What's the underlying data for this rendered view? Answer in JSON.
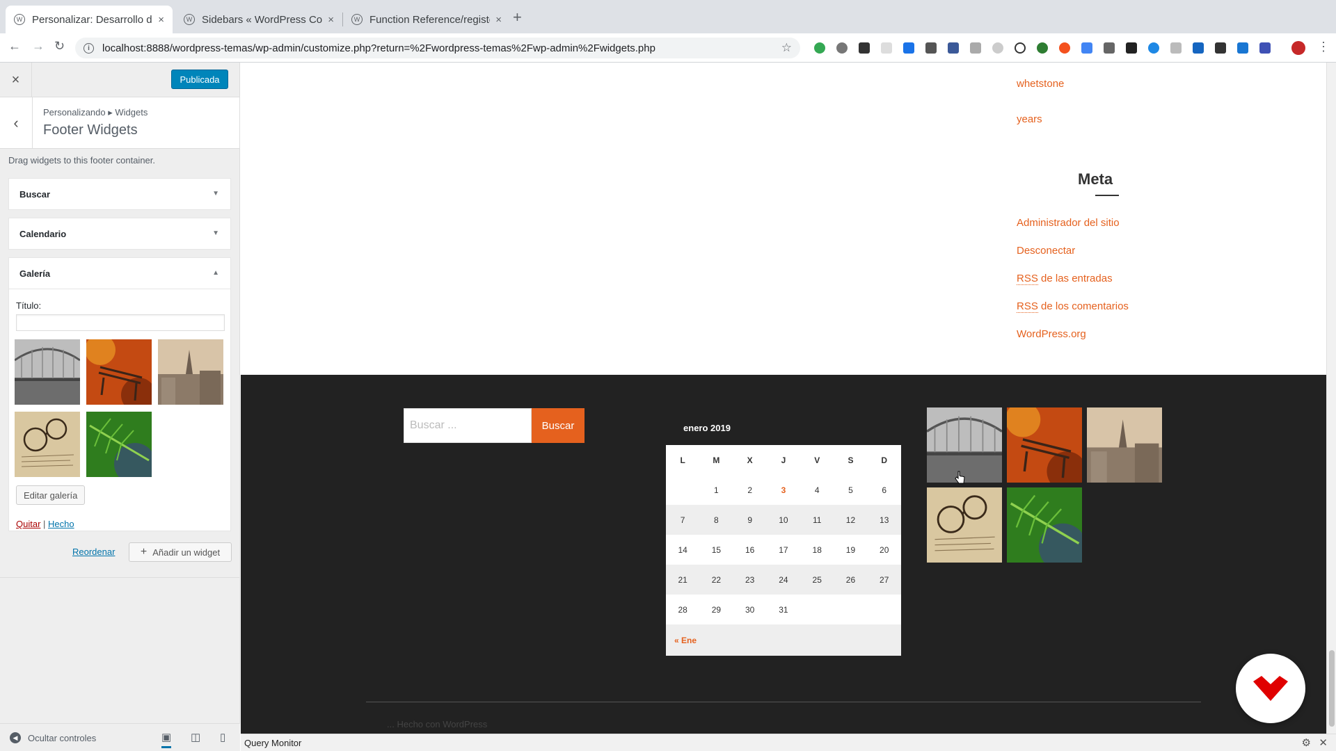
{
  "browser": {
    "tabs": [
      {
        "title": "Personalizar: Desarrollo de Ter",
        "active": true
      },
      {
        "title": "Sidebars « WordPress Codex",
        "active": false
      },
      {
        "title": "Function Reference/register si",
        "active": false
      }
    ],
    "close_glyph": "×",
    "new_tab_glyph": "+",
    "url": "localhost:8888/wordpress-temas/wp-admin/customize.php?return=%2Fwordpress-temas%2Fwp-admin%2Fwidgets.php",
    "icons": [
      "back-arrow",
      "forward-arrow",
      "reload",
      "info",
      "bookmark-star"
    ]
  },
  "customizer": {
    "close_glyph": "×",
    "publish_label": "Publicada",
    "back_glyph": "‹",
    "breadcrumb": "Personalizando ▸ Widgets",
    "section_title": "Footer Widgets",
    "description": "Drag widgets to this footer container.",
    "widgets": [
      {
        "title": "Buscar",
        "expanded": false
      },
      {
        "title": "Calendario",
        "expanded": false
      },
      {
        "title": "Galería",
        "expanded": true
      }
    ],
    "gallery": {
      "title_label": "Título:",
      "title_value": "",
      "edit_button": "Editar galería",
      "remove_link": "Quitar",
      "separator": "|",
      "done_link": "Hecho"
    },
    "reorder_link": "Reordenar",
    "add_widget_label": "Añadir un widget",
    "collapse_label": "Ocultar controles",
    "accent": "#0085ba"
  },
  "preview": {
    "tag_links": [
      "whetstone",
      "years"
    ],
    "meta_title": "Meta",
    "meta_links": [
      {
        "prefix": "",
        "text": "Administrador del sitio"
      },
      {
        "prefix": "",
        "text": "Desconectar"
      },
      {
        "prefix": "RSS",
        "text": " de las entradas"
      },
      {
        "prefix": "RSS",
        "text": " de los comentarios"
      },
      {
        "prefix": "",
        "text": "WordPress.org"
      }
    ],
    "search_placeholder": "Buscar ...",
    "search_button": "Buscar",
    "calendar": {
      "caption": "enero 2019",
      "headers": [
        "L",
        "M",
        "X",
        "J",
        "V",
        "S",
        "D"
      ],
      "weeks": [
        [
          "",
          "1",
          "2",
          "3",
          "4",
          "5",
          "6"
        ],
        [
          "7",
          "8",
          "9",
          "10",
          "11",
          "12",
          "13"
        ],
        [
          "14",
          "15",
          "16",
          "17",
          "18",
          "19",
          "20"
        ],
        [
          "21",
          "22",
          "23",
          "24",
          "25",
          "26",
          "27"
        ],
        [
          "28",
          "29",
          "30",
          "31",
          "",
          "",
          ""
        ]
      ],
      "today": "3",
      "prev_link": "« Ene"
    },
    "footer_text": "... Hecho con WordPress",
    "accent": "#e5611e",
    "footer_bg": "#222222"
  },
  "query_monitor": {
    "label": "Query Monitor"
  }
}
